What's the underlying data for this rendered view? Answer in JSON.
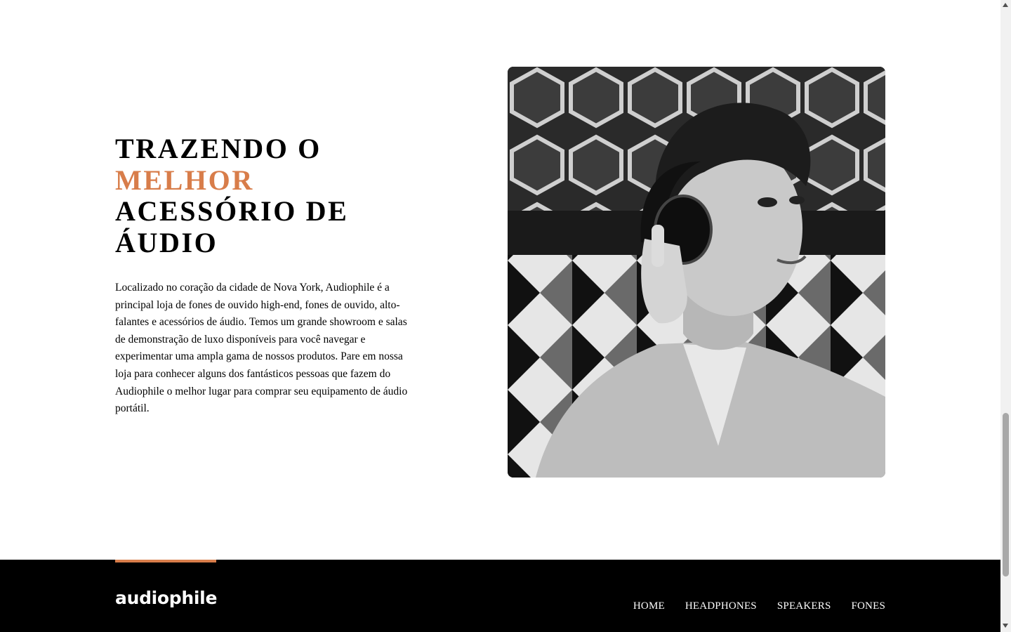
{
  "about": {
    "title_line1": "TRAZENDO O",
    "title_accent": "MELHOR",
    "title_line3": "ACESSÓRIO DE",
    "title_line4": "ÁUDIO",
    "description": "Localizado no coração da cidade de Nova York, Audiophile é a principal loja de fones de ouvido high-end, fones de ouvido, alto-falantes e acessórios de áudio. Temos um grande showroom e salas de demonstração de luxo disponíveis para você navegar e experimentar uma ampla gama de nossos produtos. Pare em nossa loja para conhecer alguns dos fantásticos pessoas que fazem do Audiophile o melhor lugar para comprar seu equipamento de áudio portátil."
  },
  "footer": {
    "logo": "audiophile",
    "nav": [
      "HOME",
      "HEADPHONES",
      "SPEAKERS",
      "FONES"
    ]
  },
  "colors": {
    "accent": "#d87d4a",
    "footer_bg": "#000000",
    "text": "#000000"
  }
}
